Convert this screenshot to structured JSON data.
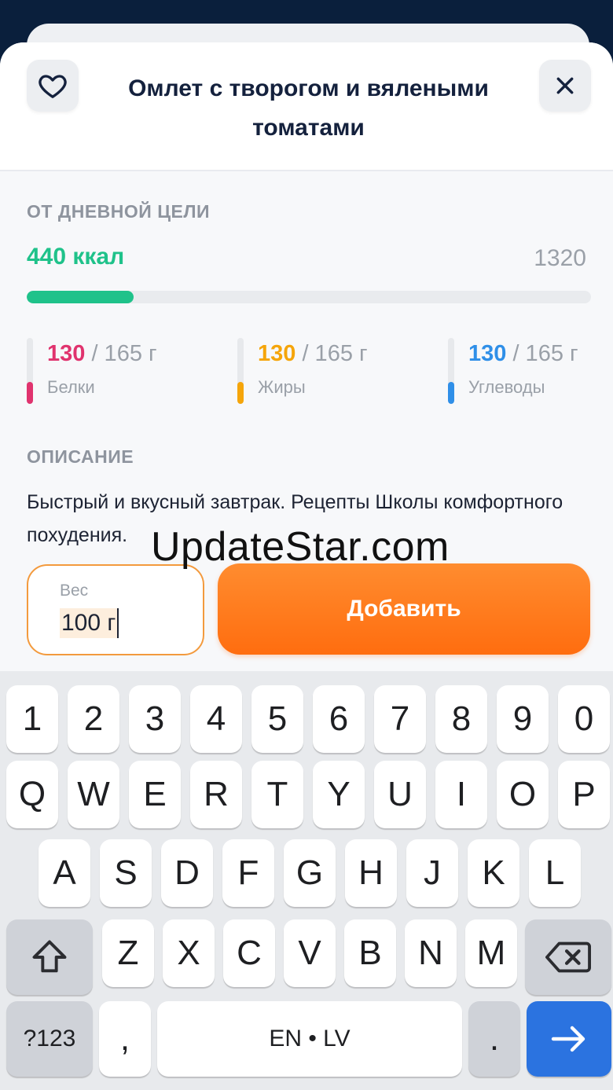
{
  "recipe": {
    "title": "Омлет с творогом и вялеными томатами"
  },
  "daily_goal": {
    "section_label": "ОТ ДНЕВНОЙ ЦЕЛИ",
    "kcal_text": "440 ккал",
    "goal_text": "1320",
    "progress_fraction": 0.19
  },
  "macros": [
    {
      "current": "130",
      "total": " / 165 г",
      "name": "Белки",
      "color": "#e0336e",
      "fill_fraction": 0.33
    },
    {
      "current": "130",
      "total": " / 165 г",
      "name": "Жиры",
      "color": "#f5a50a",
      "fill_fraction": 0.33
    },
    {
      "current": "130",
      "total": " / 165 г",
      "name": "Углеводы",
      "color": "#2f8fe8",
      "fill_fraction": 0.33
    }
  ],
  "description": {
    "section_label": "ОПИСАНИЕ",
    "text": "Быстрый и вкусный завтрак. Рецепты Школы комфортного похудения."
  },
  "watermark": "UpdateStar.com",
  "weight": {
    "label": "Вес",
    "value": "100 г"
  },
  "add_button": "Добавить",
  "colors": {
    "accent_green": "#1fc28a",
    "accent_orange": "#ff7a1a",
    "title_navy": "#14213d",
    "keyboard_enter_blue": "#2b73e0"
  },
  "keyboard": {
    "row_numbers": [
      "1",
      "2",
      "3",
      "4",
      "5",
      "6",
      "7",
      "8",
      "9",
      "0"
    ],
    "row_top": [
      "Q",
      "W",
      "E",
      "R",
      "T",
      "Y",
      "U",
      "I",
      "O",
      "P"
    ],
    "row_mid": [
      "A",
      "S",
      "D",
      "F",
      "G",
      "H",
      "J",
      "K",
      "L"
    ],
    "row_bottom": [
      "Z",
      "X",
      "C",
      "V",
      "B",
      "N",
      "M"
    ],
    "symbols_key": "?123",
    "comma_key": ",",
    "space_key": "EN • LV",
    "period_key": ".",
    "shift_icon": "shift-arrow-icon",
    "backspace_icon": "backspace-icon",
    "enter_icon": "arrow-right-icon"
  }
}
